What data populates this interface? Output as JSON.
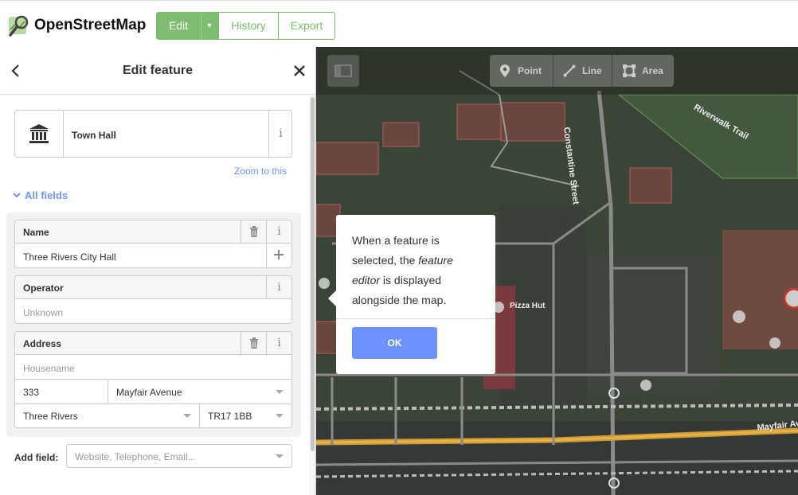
{
  "app": {
    "title": "OpenStreetMap"
  },
  "toolbar": {
    "edit_label": "Edit",
    "history_label": "History",
    "export_label": "Export",
    "accent": "#7ebc6f"
  },
  "panel": {
    "title": "Edit feature",
    "preset": {
      "name": "Town Hall",
      "icon": "town-hall-icon"
    },
    "zoom_link": "Zoom to this",
    "section_label": "All fields",
    "fields": {
      "name": {
        "label": "Name",
        "value": "Three Rivers City Hall"
      },
      "operator": {
        "label": "Operator",
        "placeholder": "Unknown"
      },
      "address": {
        "label": "Address",
        "housename_placeholder": "Housename",
        "housenumber": "333",
        "street": "Mayfair Avenue",
        "city": "Three Rivers",
        "postcode": "TR17 1BB"
      }
    },
    "add_field": {
      "label": "Add field:",
      "placeholder": "Website, Telephone, Email..."
    }
  },
  "map": {
    "modes": [
      {
        "label": "Point",
        "icon": "point-icon"
      },
      {
        "label": "Line",
        "icon": "line-icon"
      },
      {
        "label": "Area",
        "icon": "area-icon"
      }
    ],
    "labels": {
      "street": "Constantine Street",
      "trail": "Riverwalk Trail",
      "poi": "Pizza Hut",
      "avenue": "Mayfair Avenue"
    }
  },
  "tooltip": {
    "text_before": "When a feature is selected, the ",
    "text_em": "feature editor",
    "text_after": " is displayed alongside the map.",
    "ok_label": "OK",
    "accent": "#7092ff"
  }
}
